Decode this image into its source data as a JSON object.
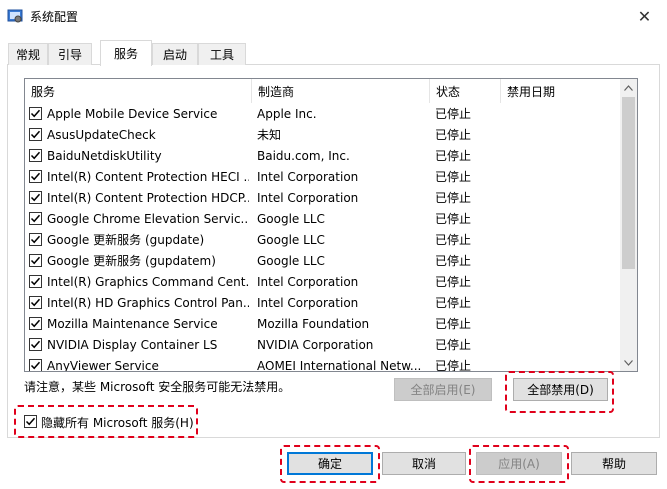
{
  "window": {
    "title": "系统配置",
    "close_glyph": "✕"
  },
  "tabs": [
    "常规",
    "引导",
    "服务",
    "启动",
    "工具"
  ],
  "active_tab": "服务",
  "columns": [
    "服务",
    "制造商",
    "状态",
    "禁用日期"
  ],
  "services": [
    {
      "name": "Apple Mobile Device Service",
      "maker": "Apple Inc.",
      "status": "已停止",
      "date": ""
    },
    {
      "name": "AsusUpdateCheck",
      "maker": "未知",
      "status": "已停止",
      "date": ""
    },
    {
      "name": "BaiduNetdiskUtility",
      "maker": "Baidu.com, Inc.",
      "status": "已停止",
      "date": ""
    },
    {
      "name": "Intel(R) Content Protection HECI ...",
      "maker": "Intel Corporation",
      "status": "已停止",
      "date": ""
    },
    {
      "name": "Intel(R) Content Protection HDCP...",
      "maker": "Intel Corporation",
      "status": "已停止",
      "date": ""
    },
    {
      "name": "Google Chrome Elevation Servic...",
      "maker": "Google LLC",
      "status": "已停止",
      "date": ""
    },
    {
      "name": "Google 更新服务 (gupdate)",
      "maker": "Google LLC",
      "status": "已停止",
      "date": ""
    },
    {
      "name": "Google 更新服务 (gupdatem)",
      "maker": "Google LLC",
      "status": "已停止",
      "date": ""
    },
    {
      "name": "Intel(R) Graphics Command Cent...",
      "maker": "Intel Corporation",
      "status": "已停止",
      "date": ""
    },
    {
      "name": "Intel(R) HD Graphics Control Pan...",
      "maker": "Intel Corporation",
      "status": "已停止",
      "date": ""
    },
    {
      "name": "Mozilla Maintenance Service",
      "maker": "Mozilla Foundation",
      "status": "已停止",
      "date": ""
    },
    {
      "name": "NVIDIA Display Container LS",
      "maker": "NVIDIA Corporation",
      "status": "已停止",
      "date": ""
    },
    {
      "name": "AnyViewer Service",
      "maker": "AOMEI International Netw...",
      "status": "已停止",
      "date": ""
    }
  ],
  "note": "请注意，某些 Microsoft 安全服务可能无法禁用。",
  "buttons": {
    "enable_all": "全部启用(E)",
    "disable_all": "全部禁用(D)",
    "ok": "确定",
    "cancel": "取消",
    "apply": "应用(A)",
    "help": "帮助"
  },
  "hide_ms_label": "隐藏所有 Microsoft 服务(H)",
  "colors": {
    "highlight": "#e0001b",
    "focus": "#0078d7"
  }
}
